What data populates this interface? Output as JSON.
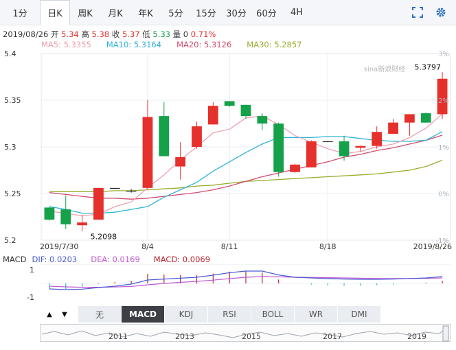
{
  "tabs": [
    "1分",
    "日K",
    "周K",
    "月K",
    "年K",
    "5分",
    "15分",
    "30分",
    "60分",
    "4H"
  ],
  "active_tab": 1,
  "toolbar_icons": [
    "fullscreen-icon",
    "settings-gear-icon"
  ],
  "info": {
    "date": "2019/08/26",
    "open_label": "开",
    "open": "5.34",
    "high_label": "高",
    "high": "5.38",
    "close_label": "收",
    "close": "5.37",
    "low_label": "低",
    "low": "5.33",
    "volume_label": "量",
    "volume": "0",
    "change": "0.71%"
  },
  "ma": [
    {
      "label": "MA5: 5.3355",
      "color": "#f0a0b0"
    },
    {
      "label": "MA10: 5.3164",
      "color": "#2fb3d6"
    },
    {
      "label": "MA20: 5.3126",
      "color": "#d24c6e"
    },
    {
      "label": "MA30: 5.2857",
      "color": "#9aac2c"
    }
  ],
  "watermark": "sina新浪财经",
  "chart_data": {
    "type": "candlestick",
    "price_axis": {
      "ticks": [
        5.4,
        5.35,
        5.3,
        5.25,
        5.2
      ],
      "min": 5.2,
      "max": 5.4
    },
    "pct_axis": {
      "ticks": [
        "3%",
        "2%",
        "1%",
        "0%",
        "-1%"
      ]
    },
    "x_labels": [
      "2019/7/30",
      "8/4",
      "8/11",
      "8/18",
      "2019/8/26"
    ],
    "annotations": {
      "max": "5.3797",
      "min": "5.2098"
    },
    "candles": [
      {
        "date": "2019/7/30",
        "o": 5.235,
        "h": 5.236,
        "l": 5.221,
        "c": 5.222
      },
      {
        "o": 5.233,
        "h": 5.248,
        "l": 5.212,
        "c": 5.217
      },
      {
        "o": 5.216,
        "h": 5.227,
        "l": 5.2098,
        "c": 5.219
      },
      {
        "o": 5.222,
        "h": 5.256,
        "l": 5.222,
        "c": 5.256
      },
      {
        "o": 5.256,
        "h": 5.256,
        "l": 5.256,
        "c": 5.256
      },
      {
        "o": 5.253,
        "h": 5.255,
        "l": 5.251,
        "c": 5.253
      },
      {
        "date": "8/4",
        "o": 5.256,
        "h": 5.35,
        "l": 5.255,
        "c": 5.332
      },
      {
        "o": 5.333,
        "h": 5.348,
        "l": 5.29,
        "c": 5.29
      },
      {
        "o": 5.279,
        "h": 5.305,
        "l": 5.265,
        "c": 5.289
      },
      {
        "o": 5.3,
        "h": 5.327,
        "l": 5.298,
        "c": 5.322
      },
      {
        "o": 5.324,
        "h": 5.348,
        "l": 5.324,
        "c": 5.344
      },
      {
        "date": "8/11",
        "o": 5.349,
        "h": 5.349,
        "l": 5.343,
        "c": 5.344
      },
      {
        "o": 5.345,
        "h": 5.345,
        "l": 5.33,
        "c": 5.333
      },
      {
        "o": 5.333,
        "h": 5.336,
        "l": 5.318,
        "c": 5.325
      },
      {
        "o": 5.325,
        "h": 5.326,
        "l": 5.268,
        "c": 5.273
      },
      {
        "o": 5.273,
        "h": 5.282,
        "l": 5.272,
        "c": 5.281
      },
      {
        "o": 5.278,
        "h": 5.307,
        "l": 5.278,
        "c": 5.306
      },
      {
        "date": "8/18",
        "o": 5.306,
        "h": 5.306,
        "l": 5.305,
        "c": 5.306
      },
      {
        "o": 5.306,
        "h": 5.312,
        "l": 5.285,
        "c": 5.29
      },
      {
        "o": 5.299,
        "h": 5.301,
        "l": 5.295,
        "c": 5.301
      },
      {
        "o": 5.301,
        "h": 5.322,
        "l": 5.298,
        "c": 5.316
      },
      {
        "o": 5.314,
        "h": 5.33,
        "l": 5.314,
        "c": 5.326
      },
      {
        "o": 5.326,
        "h": 5.335,
        "l": 5.312,
        "c": 5.335
      },
      {
        "o": 5.336,
        "h": 5.337,
        "l": 5.326,
        "c": 5.326
      },
      {
        "date": "2019/8/26",
        "o": 5.335,
        "h": 5.38,
        "l": 5.33,
        "c": 5.373
      }
    ],
    "ma5": [
      5.231,
      5.229,
      5.226,
      5.228,
      5.236,
      5.241,
      5.256,
      5.27,
      5.286,
      5.3,
      5.315,
      5.319,
      5.331,
      5.333,
      5.324,
      5.312,
      5.305,
      5.298,
      5.293,
      5.295,
      5.3,
      5.303,
      5.31,
      5.32,
      5.3355
    ],
    "ma10": [
      5.236,
      5.233,
      5.229,
      5.229,
      5.23,
      5.233,
      5.236,
      5.246,
      5.254,
      5.262,
      5.274,
      5.284,
      5.294,
      5.303,
      5.31,
      5.31,
      5.31,
      5.311,
      5.311,
      5.309,
      5.307,
      5.306,
      5.306,
      5.307,
      5.3164
    ],
    "ma20": [
      5.251,
      5.249,
      5.247,
      5.245,
      5.245,
      5.244,
      5.245,
      5.247,
      5.249,
      5.251,
      5.254,
      5.258,
      5.263,
      5.268,
      5.272,
      5.276,
      5.28,
      5.284,
      5.289,
      5.292,
      5.296,
      5.299,
      5.303,
      5.307,
      5.3126
    ],
    "ma30": [
      5.252,
      5.252,
      5.252,
      5.252,
      5.253,
      5.253,
      5.254,
      5.255,
      5.256,
      5.258,
      5.259,
      5.261,
      5.263,
      5.264,
      5.265,
      5.266,
      5.267,
      5.268,
      5.269,
      5.27,
      5.271,
      5.273,
      5.275,
      5.279,
      5.2857
    ],
    "macd_panel": {
      "title": "MACD",
      "dif_label": "DIF: 0.0203",
      "dea_label": "DEA: 0.0169",
      "macd_label": "MACD: 0.0069",
      "axis_ticks": [
        "1",
        "-1"
      ],
      "dif": [
        -0.4,
        -0.45,
        -0.42,
        -0.3,
        -0.2,
        -0.05,
        0.25,
        0.32,
        0.38,
        0.45,
        0.6,
        0.78,
        0.9,
        0.9,
        0.62,
        0.45,
        0.4,
        0.35,
        0.32,
        0.3,
        0.3,
        0.32,
        0.36,
        0.4,
        0.5
      ],
      "dea": [
        -0.2,
        -0.25,
        -0.28,
        -0.28,
        -0.26,
        -0.22,
        -0.1,
        0.0,
        0.08,
        0.15,
        0.24,
        0.35,
        0.45,
        0.5,
        0.48,
        0.45,
        0.44,
        0.42,
        0.4,
        0.38,
        0.36,
        0.36,
        0.36,
        0.37,
        0.4
      ],
      "hist": [
        -0.4,
        -0.4,
        -0.3,
        -0.05,
        0.1,
        0.2,
        0.7,
        0.64,
        0.6,
        0.6,
        0.72,
        0.86,
        0.9,
        0.8,
        0.28,
        -0.01,
        -0.08,
        -0.14,
        -0.16,
        -0.16,
        -0.12,
        -0.08,
        0.0,
        0.06,
        0.2
      ]
    }
  },
  "indicator_tabs": [
    "无",
    "MACD",
    "KDJ",
    "RSI",
    "BOLL",
    "WR",
    "DMI"
  ],
  "active_indicator": 1,
  "arrows": {
    "up": "▲",
    "down": "▼"
  },
  "navigator_years": [
    "2011",
    "2013",
    "2015",
    "2017",
    "2019"
  ]
}
